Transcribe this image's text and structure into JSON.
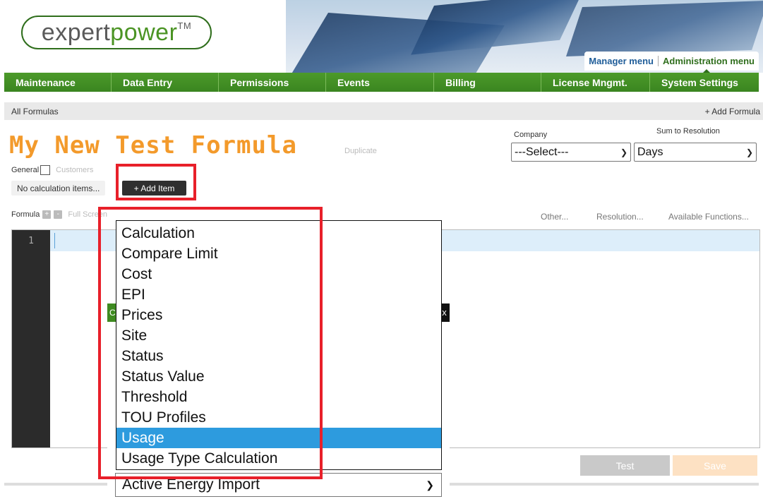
{
  "header": {
    "logo": {
      "part1": "expert",
      "part2": "power",
      "tm": "TM"
    },
    "manager_menu": "Manager menu",
    "admin_menu": "Administration menu"
  },
  "nav": [
    {
      "label": "Maintenance"
    },
    {
      "label": "Data Entry"
    },
    {
      "label": "Permissions"
    },
    {
      "label": "Events"
    },
    {
      "label": "Billing"
    },
    {
      "label": "License Mngmt."
    },
    {
      "label": "System Settings"
    }
  ],
  "breadcrumb": {
    "current": "All Formulas",
    "add_formula": "+ Add Formula"
  },
  "formula": {
    "title": "My New Test Formula",
    "duplicate": "Duplicate",
    "general_label": "General",
    "customers_label": "Customers",
    "calc_items": "No calculation items...",
    "add_item": "+ Add Item"
  },
  "company": {
    "label": "Company",
    "value": "---Select---"
  },
  "resolution": {
    "label": "Sum to Resolution",
    "value": "Days"
  },
  "toolbar": {
    "formula_label": "Formula",
    "plus": "+",
    "minus": "-",
    "full_screen": "Full Screen",
    "other": "Other...",
    "resolution": "Resolution...",
    "available_functions": "Available Functions..."
  },
  "editor": {
    "line_numbers": [
      "1"
    ]
  },
  "actions": {
    "test": "Test",
    "save": "Save"
  },
  "dialog": {
    "title_fragment": "C",
    "close_fragment": "x"
  },
  "dropdown": {
    "items": [
      "Calculation",
      "Compare Limit",
      "Cost",
      "EPI",
      "Prices",
      "Site",
      "Status",
      "Status Value",
      "Threshold",
      "TOU Profiles",
      "Usage",
      "Usage Type Calculation"
    ],
    "selected": "Usage"
  },
  "usage_type_select": {
    "value": "Active Energy Import"
  },
  "colors": {
    "brand_green": "#3a8520",
    "title_orange": "#f39a2b",
    "highlight_red": "#e8202a",
    "selection_blue": "#2d9bde"
  }
}
